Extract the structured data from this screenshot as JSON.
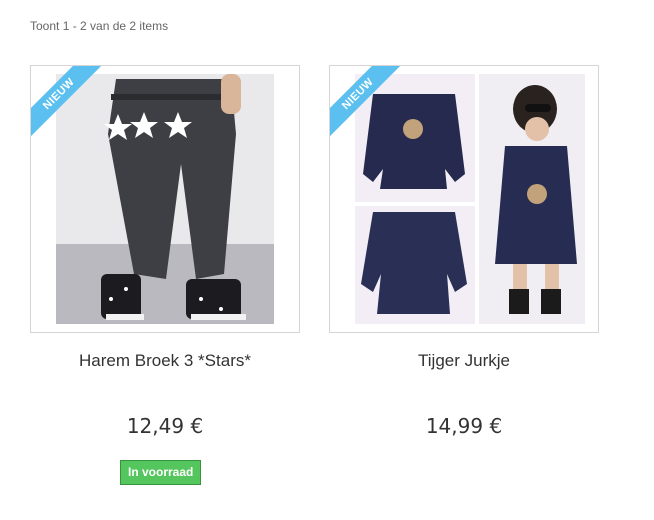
{
  "listing": {
    "count_text": "Toont 1 - 2 van de 2 items"
  },
  "products": [
    {
      "badge": "NIEUW",
      "name": "Harem Broek 3 *Stars*",
      "price": "12,49 €",
      "stock": "In voorraad"
    },
    {
      "badge": "NIEUW",
      "name": "Tijger Jurkje",
      "price": "14,99 €"
    }
  ],
  "colors": {
    "badge": "#5bc0ef",
    "stock": "#55c65e",
    "text": "#333333"
  }
}
